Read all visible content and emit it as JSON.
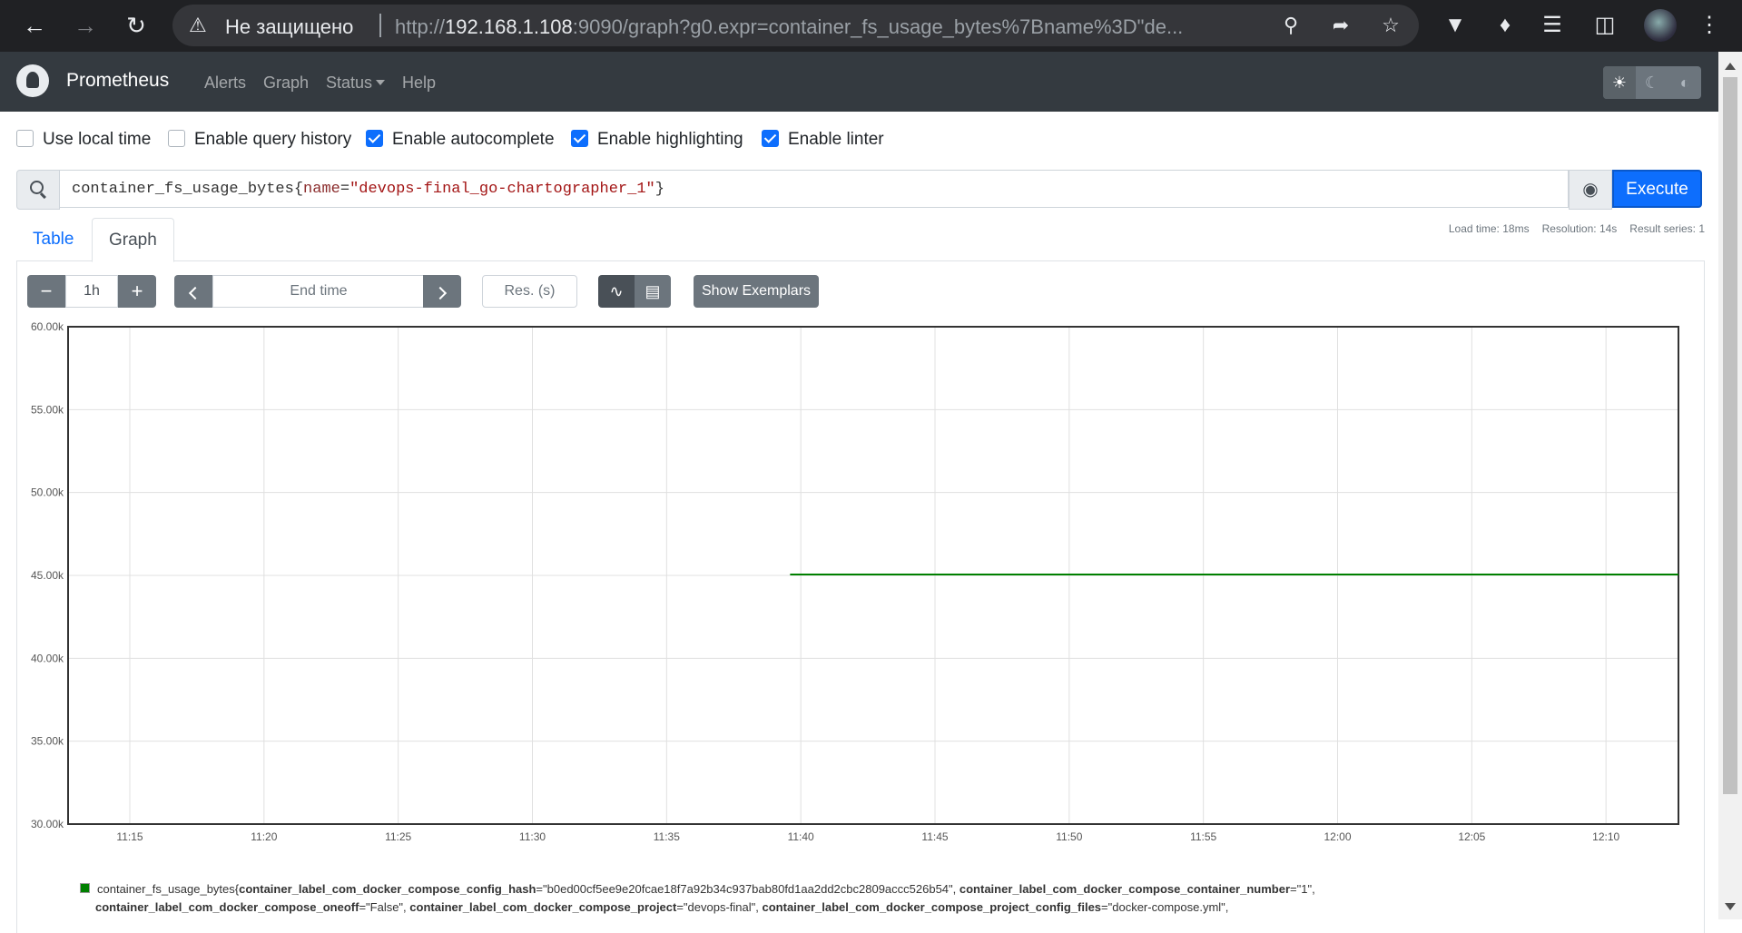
{
  "browser": {
    "back_icon": "back-arrow-icon",
    "forward_icon": "forward-arrow-icon",
    "reload_icon": "reload-icon",
    "security_label": "Не защищено",
    "url_prefix": "http://",
    "url_host": "192.168.1.108",
    "url_rest": ":9090/graph?g0.expr=container_fs_usage_bytes%7Bname%3D\"de..."
  },
  "navbar": {
    "brand": "Prometheus",
    "links": [
      "Alerts",
      "Graph",
      "Status",
      "Help"
    ]
  },
  "options": [
    {
      "label": "Use local time",
      "checked": false
    },
    {
      "label": "Enable query history",
      "checked": false
    },
    {
      "label": "Enable autocomplete",
      "checked": true
    },
    {
      "label": "Enable highlighting",
      "checked": true
    },
    {
      "label": "Enable linter",
      "checked": true
    }
  ],
  "query": {
    "metric": "container_fs_usage_bytes",
    "label_name": "name",
    "label_value": "\"devops-final_go-chartographer_1\"",
    "execute_label": "Execute"
  },
  "tabs": {
    "table": "Table",
    "graph": "Graph"
  },
  "stats": {
    "load_time": "Load time: 18ms",
    "resolution": "Resolution: 14s",
    "result_series": "Result series: 1"
  },
  "graph_controls": {
    "minus": "−",
    "range": "1h",
    "plus": "+",
    "end_time_placeholder": "End time",
    "res_placeholder": "Res. (s)",
    "exemplars_label": "Show Exemplars"
  },
  "chart_data": {
    "type": "line",
    "y_ticks": [
      "60.00k",
      "55.00k",
      "50.00k",
      "45.00k",
      "40.00k",
      "35.00k",
      "30.00k"
    ],
    "ylim": [
      30000,
      60000
    ],
    "x_ticks": [
      "11:15",
      "11:20",
      "11:25",
      "11:30",
      "11:35",
      "11:40",
      "11:45",
      "11:50",
      "11:55",
      "12:00",
      "12:05",
      "12:10"
    ],
    "x_range_minutes": [
      "11:12.7",
      "12:12.7"
    ],
    "grid": true,
    "series": [
      {
        "color": "#008000",
        "x": [
          "11:39.6",
          "12:12.7"
        ],
        "values": [
          45056,
          45056
        ]
      }
    ]
  },
  "legend": {
    "metric": "container_fs_usage_bytes",
    "line1": [
      {
        "k": "container_label_com_docker_compose_config_hash",
        "v": "\"b0ed00cf5ee9e20fcae18f7a92b34c937bab80fd1aa2dd2cbc2809accc526b54\""
      },
      {
        "k": "container_label_com_docker_compose_container_number",
        "v": "\"1\""
      }
    ],
    "line2": [
      {
        "k": "container_label_com_docker_compose_oneoff",
        "v": "\"False\""
      },
      {
        "k": "container_label_com_docker_compose_project",
        "v": "\"devops-final\""
      },
      {
        "k": "container_label_com_docker_compose_project_config_files",
        "v": "\"docker-compose.yml\""
      }
    ]
  }
}
